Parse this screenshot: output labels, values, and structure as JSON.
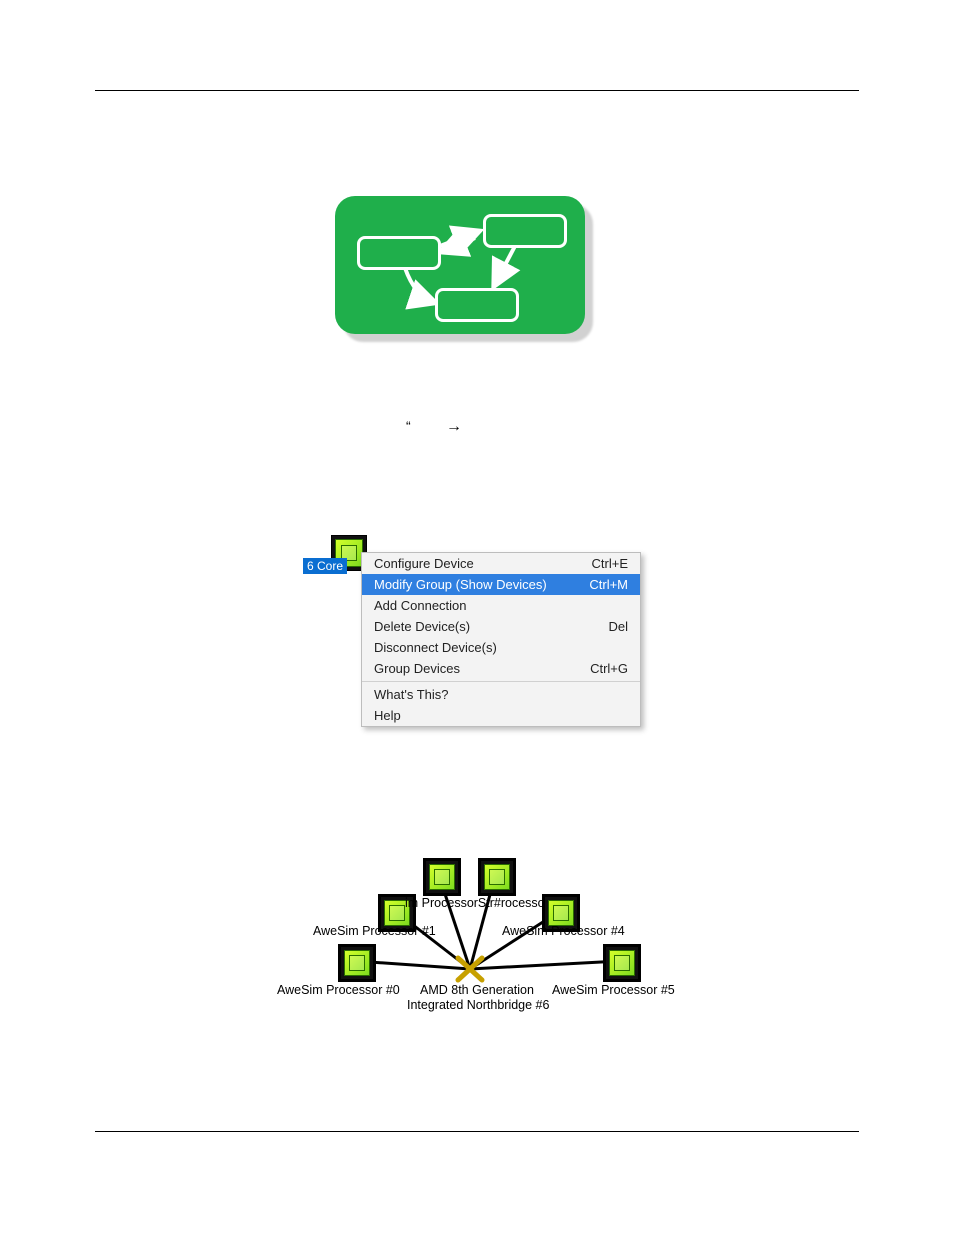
{
  "fig1_alt": "Green rounded rectangle icon containing three rounded white-outlined boxes connected by white arrows",
  "context_menu": {
    "selected_label": "6 Core",
    "items": [
      {
        "label": "Configure Device",
        "shortcut": "Ctrl+E",
        "highlighted": false
      },
      {
        "label": "Modify Group (Show Devices)",
        "shortcut": "Ctrl+M",
        "highlighted": true
      },
      {
        "label": "Add Connection",
        "shortcut": "",
        "highlighted": false
      },
      {
        "label": "Delete Device(s)",
        "shortcut": "Del",
        "highlighted": false
      },
      {
        "label": "Disconnect Device(s)",
        "shortcut": "",
        "highlighted": false
      },
      {
        "label": "Group Devices",
        "shortcut": "Ctrl+G",
        "highlighted": false
      }
    ],
    "after_sep": [
      {
        "label": "What's This?",
        "shortcut": ""
      },
      {
        "label": "Help",
        "shortcut": ""
      }
    ]
  },
  "diagram": {
    "labels": {
      "p0": "AweSim Processor #0",
      "p1": "AweSim Processor #1",
      "p2_overlap": "im ProcessorStr#rocesso",
      "p4": "AweSim Processor #4",
      "p5": "AweSim Processor #5",
      "nb_line1": "AMD 8th Generation",
      "nb_line2": "Integrated Northbridge #6"
    }
  }
}
